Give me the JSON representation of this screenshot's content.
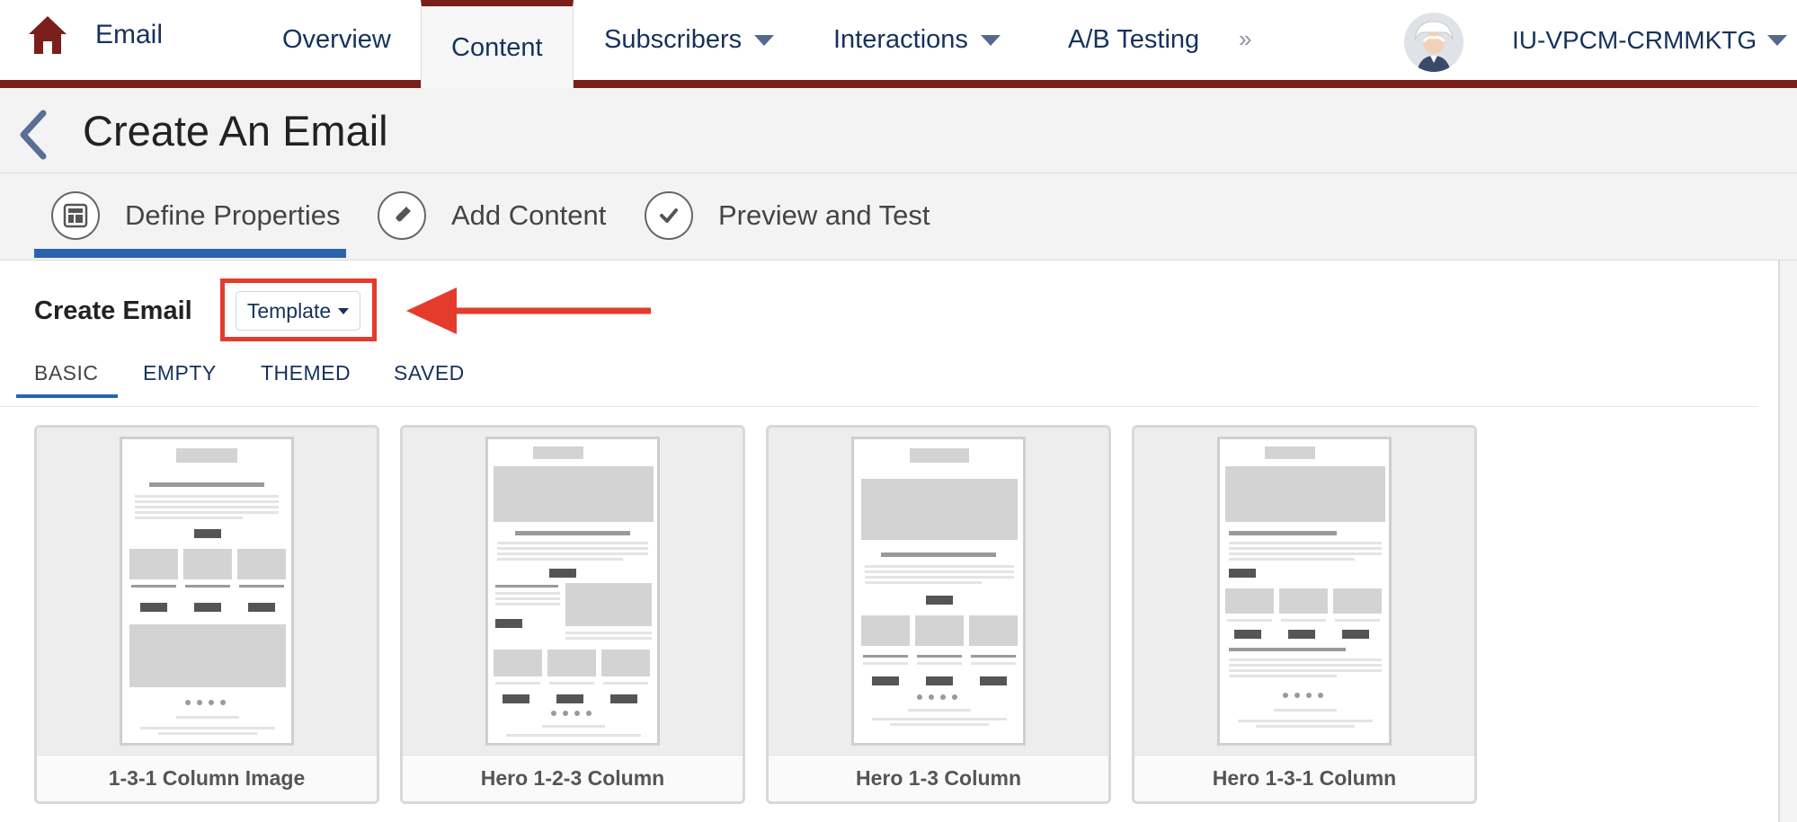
{
  "nav": {
    "brand_label": "Email",
    "items": [
      {
        "label": "Overview"
      },
      {
        "label": "Content"
      },
      {
        "label": "Subscribers"
      },
      {
        "label": "Interactions"
      },
      {
        "label": "A/B Testing"
      }
    ],
    "more_label": "»",
    "org_label": "IU-VPCM-CRMMKTG"
  },
  "page": {
    "title": "Create An Email"
  },
  "steps": [
    {
      "label": "Define Properties"
    },
    {
      "label": "Add Content"
    },
    {
      "label": "Preview and Test"
    }
  ],
  "create": {
    "label": "Create Email",
    "template_button": "Template"
  },
  "tabs": [
    {
      "label": "BASIC"
    },
    {
      "label": "EMPTY"
    },
    {
      "label": "THEMED"
    },
    {
      "label": "SAVED"
    }
  ],
  "templates": [
    {
      "label": "1-3-1 Column Image"
    },
    {
      "label": "Hero 1-2-3 Column"
    },
    {
      "label": "Hero 1-3 Column"
    },
    {
      "label": "Hero 1-3-1 Column"
    }
  ],
  "colors": {
    "brand_bar": "#7b1f1a",
    "accent_blue": "#2c62b0",
    "highlight_red": "#e53b2c"
  }
}
